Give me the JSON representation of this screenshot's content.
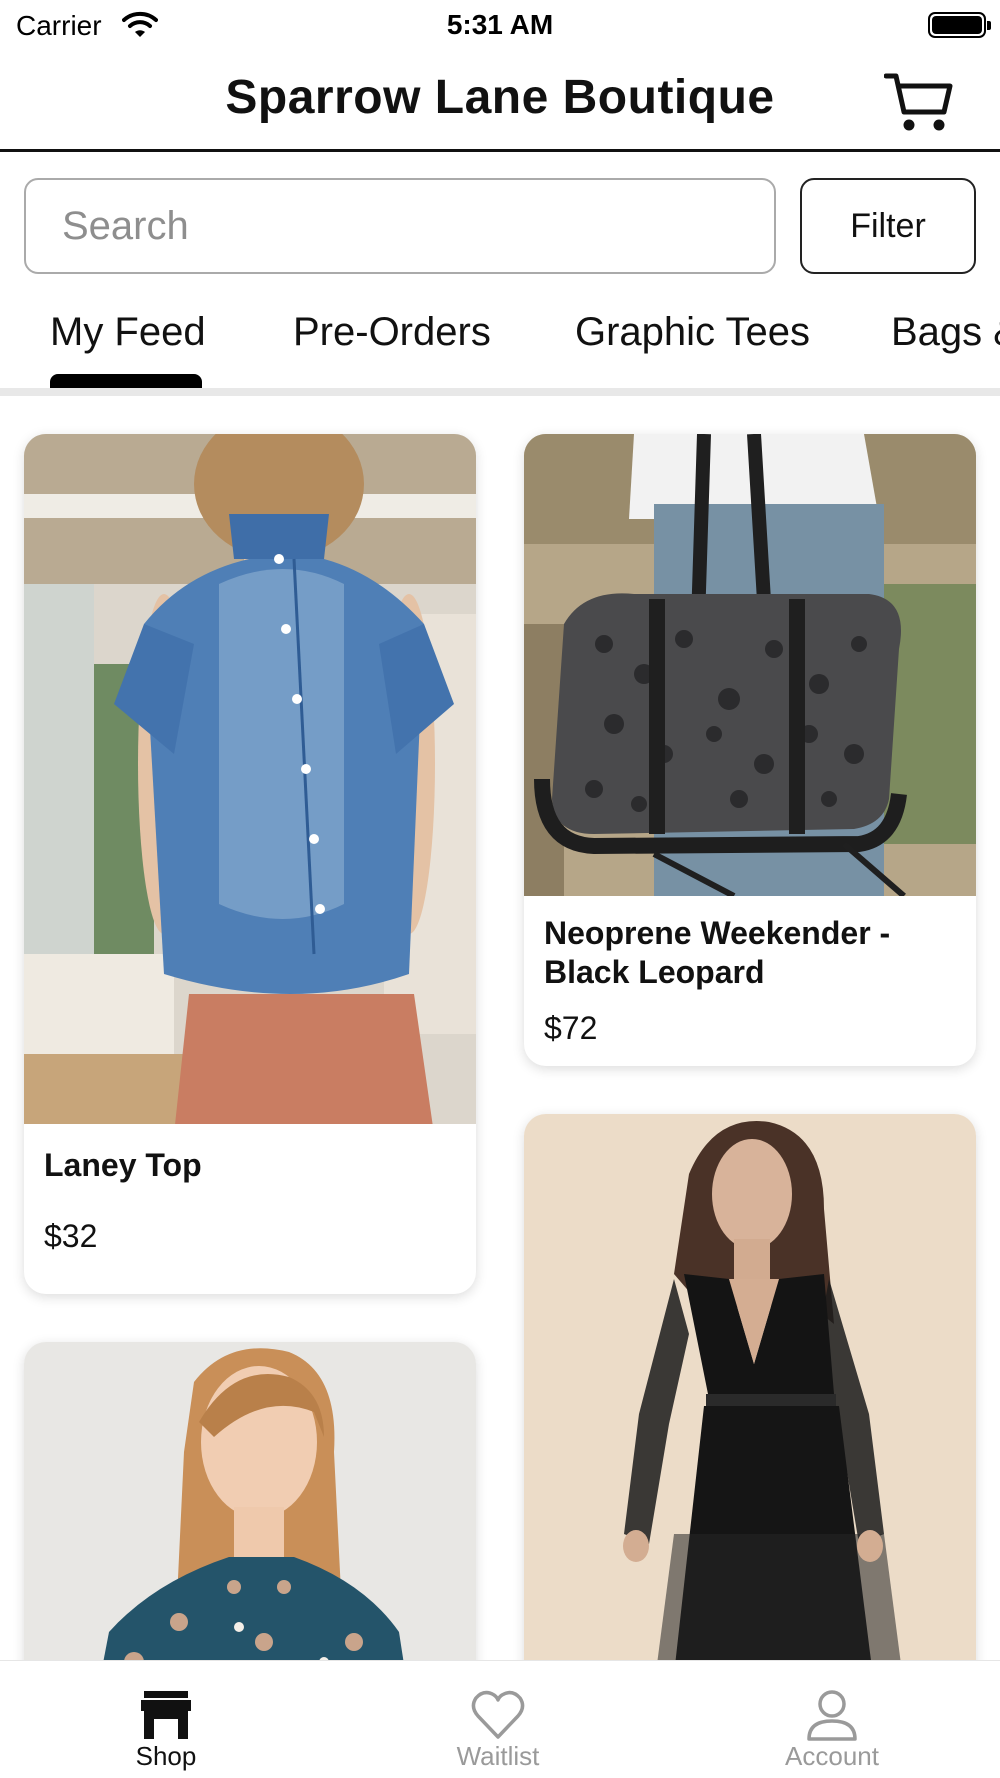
{
  "status_bar": {
    "carrier": "Carrier",
    "time": "5:31 AM",
    "icons": [
      "wifi-icon",
      "battery-icon"
    ]
  },
  "header": {
    "title": "Sparrow Lane Boutique",
    "cart_icon": "cart-icon"
  },
  "search": {
    "placeholder": "Search",
    "value": "",
    "filter_label": "Filter"
  },
  "tabs": [
    {
      "label": "My Feed",
      "selected": true
    },
    {
      "label": "Pre-Orders",
      "selected": false
    },
    {
      "label": "Graphic Tees",
      "selected": false
    },
    {
      "label": "Bags &",
      "selected": false
    }
  ],
  "products": [
    {
      "name": "Laney Top",
      "price": "$32"
    },
    {
      "name": "Neoprene Weekender - Black Leopard",
      "price": "$72"
    },
    {
      "name": "",
      "price": ""
    },
    {
      "name": "",
      "price": ""
    }
  ],
  "bottom_nav": [
    {
      "label": "Shop",
      "icon": "store-icon",
      "active": true
    },
    {
      "label": "Waitlist",
      "icon": "heart-icon",
      "active": false
    },
    {
      "label": "Account",
      "icon": "person-icon",
      "active": false
    }
  ],
  "colors": {
    "active": "#111111",
    "inactive": "#9a9a9a",
    "tab_indicator": "#000000",
    "divider": "#e8e8e8"
  }
}
